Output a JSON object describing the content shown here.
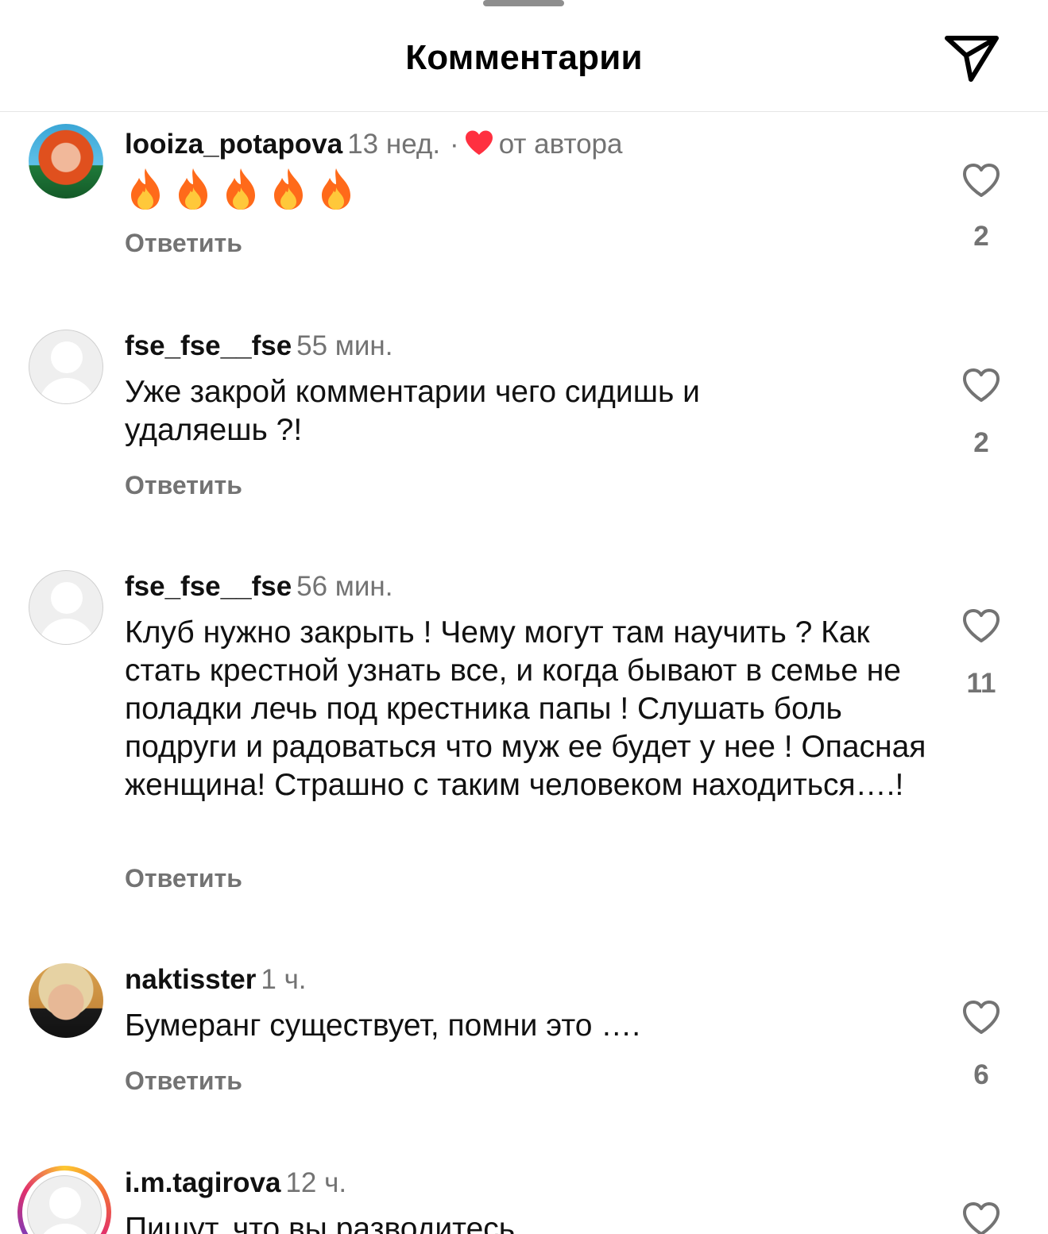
{
  "header": {
    "title": "Комментарии"
  },
  "comments": [
    {
      "username": "looiza_potapova",
      "time": "13 нед.",
      "separator": "·",
      "author_badge": "от автора",
      "text": "🔥🔥🔥🔥🔥",
      "reply_label": "Ответить",
      "likes": "2",
      "avatar": "photo"
    },
    {
      "username": "fse_fse__fse",
      "time": "55 мин.",
      "text": "Уже закрой комментарии чего сидишь и удаляешь ?!",
      "reply_label": "Ответить",
      "likes": "2",
      "avatar": "placeholder"
    },
    {
      "username": "fse_fse__fse",
      "time": "56 мин.",
      "text": "Клуб нужно закрыть ! Чему могут там научить ? Как стать крестной узнать все, и когда бывают в семье не поладки лечь под крестника папы ! Слушать боль подруги и радоваться что муж ее будет у нее ! Опасная женщина! Страшно с таким человеком находиться….!",
      "reply_label": "Ответить",
      "likes": "11",
      "avatar": "placeholder"
    },
    {
      "username": "naktisster",
      "time": "1 ч.",
      "text": "Бумеранг существует, помни это ….",
      "reply_label": "Ответить",
      "likes": "6",
      "avatar": "photo"
    },
    {
      "username": "i.m.tagirova",
      "time": "12 ч.",
      "text": "Пишут, что вы разводитесь",
      "avatar": "placeholder-story-ring"
    }
  ],
  "colors": {
    "secondary_text": "#737373",
    "like_red": "#ff3040",
    "divider": "#e6e6e6"
  },
  "icons": {
    "share": "paper-plane-icon",
    "like": "heart-outline-icon",
    "liked_by_author": "heart-filled-icon",
    "flame": "fire-emoji"
  }
}
